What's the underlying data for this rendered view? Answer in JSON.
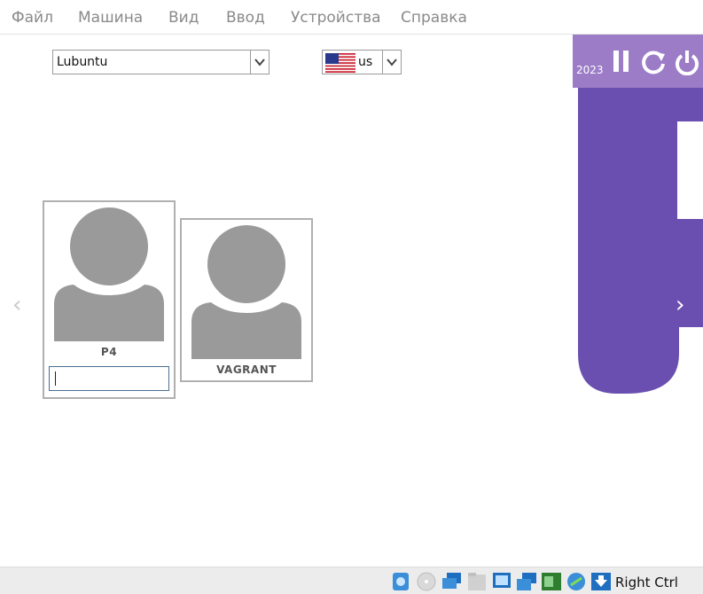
{
  "menu": {
    "items": [
      "Файл",
      "Машина",
      "Вид",
      "Ввод",
      "Устройства",
      "Справка"
    ]
  },
  "login": {
    "session_select": "Lubuntu",
    "keyboard_layout": "us",
    "users": [
      {
        "name": "P4",
        "selected": true
      },
      {
        "name": "VAGRANT",
        "selected": false
      }
    ],
    "password_value": ""
  },
  "desktop": {
    "year": "2023",
    "accent_color": "#6a4fb0"
  },
  "statusbar": {
    "host_key_label": "Right Ctrl",
    "icons": [
      "hard-disk-icon",
      "optical-drive-icon",
      "network-icon",
      "shared-folder-icon",
      "display-icon",
      "video-capture-icon",
      "usb-icon",
      "mouse-integration-icon",
      "host-key-arrow-icon"
    ]
  }
}
